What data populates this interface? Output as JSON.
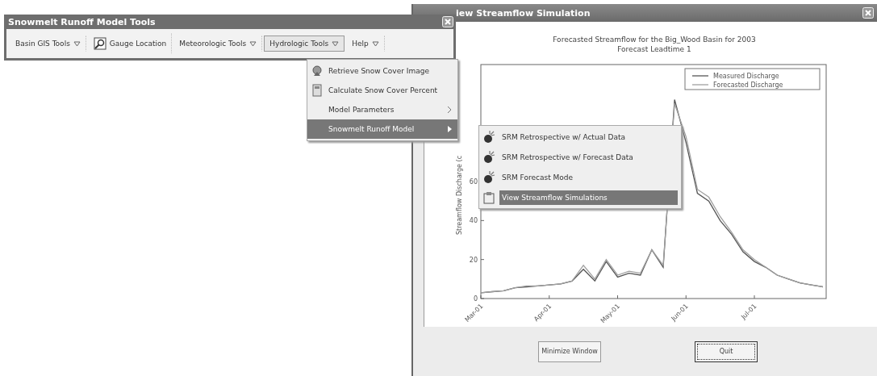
{
  "simulation_window": {
    "title": "iew Streamflow Simulation",
    "chart_subtitle": "Forecast Leadtime 1",
    "chart_data": {
      "type": "line",
      "title": "Forecasted Streamflow for the Big_Wood Basin for 2003",
      "ylabel": "Streamflow Discharge (c",
      "categories": [
        "Mar-01",
        null,
        null,
        null,
        null,
        null,
        "Apr-01",
        null,
        null,
        null,
        null,
        null,
        "May-01",
        null,
        null,
        null,
        null,
        null,
        "Jun-01",
        null,
        null,
        null,
        null,
        null,
        "Jul-01",
        null,
        null,
        null,
        null,
        null,
        null
      ],
      "series": [
        {
          "name": "Measured Discharge",
          "color": "#555555",
          "values": [
            3,
            3.5,
            4,
            5.5,
            6,
            6.5,
            7,
            7.5,
            9,
            15,
            9,
            19,
            11,
            13,
            12,
            25,
            16,
            102,
            80,
            54,
            50,
            40,
            33,
            24,
            19,
            16,
            12,
            10,
            8,
            7,
            6
          ]
        },
        {
          "name": "Forecasted Discharge",
          "color": "#a0a0a0",
          "values": [
            3,
            3.5,
            4,
            5.5,
            6.5,
            6.5,
            7,
            7.5,
            9,
            17,
            10,
            20,
            12,
            14,
            13,
            25,
            17,
            100,
            83,
            56,
            52,
            42,
            34,
            25,
            20,
            16,
            12,
            10,
            8,
            7,
            6
          ]
        }
      ],
      "ylim": [
        0,
        120
      ],
      "yticks": [
        0,
        20,
        40,
        60
      ],
      "legend": "upper right"
    },
    "buttons": [
      {
        "label": "Minimize Window",
        "focused": false
      },
      {
        "label": "Quit",
        "focused": true
      }
    ]
  },
  "toolbar_window": {
    "title": "Snowmelt Runoff Model Tools",
    "menu_bar": [
      {
        "label": "Basin GIS Tools",
        "kind": "dropdown",
        "selected": false
      },
      {
        "label": "Gauge Location",
        "kind": "tool",
        "selected": false
      },
      {
        "label": "Meteorologic Tools",
        "kind": "dropdown",
        "selected": false
      },
      {
        "label": "Hydrologic Tools",
        "kind": "dropdown",
        "selected": true
      },
      {
        "label": "Help",
        "kind": "dropdown",
        "selected": false
      }
    ]
  },
  "dropdown_menu": [
    {
      "label": "Retrieve Snow Cover Image",
      "kind": "command",
      "selected": false
    },
    {
      "label": "Calculate Snow Cover Percent",
      "kind": "command",
      "selected": false
    },
    {
      "label": "Model Parameters",
      "kind": "submenu",
      "selected": false
    },
    {
      "label": "Snowmelt Runoff Model",
      "kind": "submenu",
      "selected": true
    }
  ],
  "submenu": [
    {
      "label": "SRM Retrospective w/ Actual Data",
      "selected": false
    },
    {
      "label": "SRM Retrospective w/ Forecast Data",
      "selected": false
    },
    {
      "label": "SRM Forecast Mode",
      "selected": false
    },
    {
      "label": "View Streamflow Simulations",
      "selected": true
    }
  ]
}
